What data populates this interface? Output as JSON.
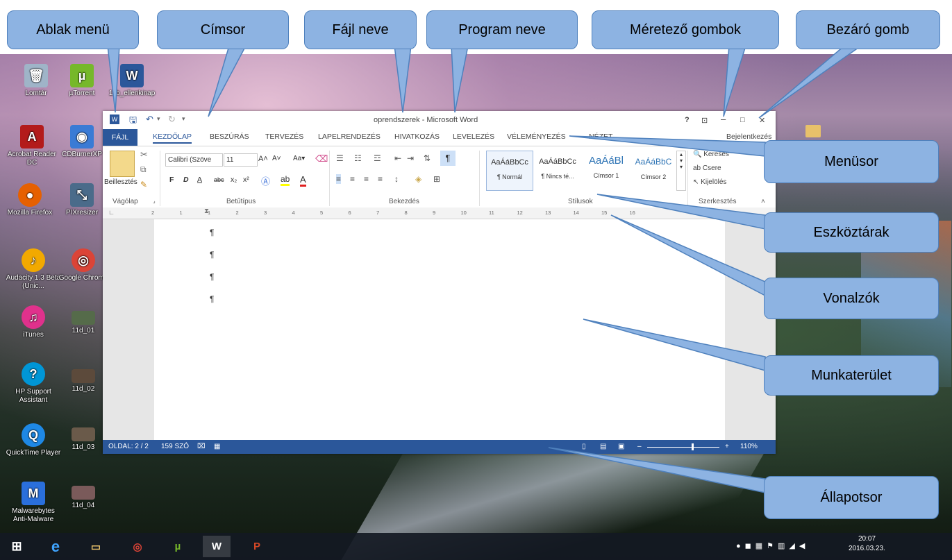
{
  "callouts": {
    "window_menu": "Ablak menü",
    "title_bar": "Címsor",
    "file_name": "Fájl neve",
    "program_name": "Program neve",
    "resize_buttons": "Méretező gombok",
    "close_button": "Bezáró gomb",
    "menubar": "Menüsor",
    "toolbars": "Eszköztárak",
    "rulers": "Vonalzók",
    "workspace": "Munkaterület",
    "statusbar": "Állapotsor"
  },
  "desktop": {
    "icons": [
      {
        "label": "Lomtár",
        "icon": "recycle-bin-icon"
      },
      {
        "label": "µTorrent",
        "icon": "utorrent-icon"
      },
      {
        "label": "11b_ellenkinap",
        "icon": "word-file-icon"
      },
      {
        "label": "Acrobat Reader DC",
        "icon": "acrobat-icon"
      },
      {
        "label": "CDBurnerXP",
        "icon": "cdburner-icon"
      },
      {
        "label": "Mozilla Firefox",
        "icon": "firefox-icon"
      },
      {
        "label": "PIXresizer",
        "icon": "pixresizer-icon"
      },
      {
        "label": "Audacity 1.3 Beta (Unic...",
        "icon": "audacity-icon"
      },
      {
        "label": "Google Chrome",
        "icon": "chrome-icon"
      },
      {
        "label": "iTunes",
        "icon": "itunes-icon"
      },
      {
        "label": "11d_01",
        "icon": "photo-icon"
      },
      {
        "label": "HP Support Assistant",
        "icon": "hp-support-icon"
      },
      {
        "label": "11d_02",
        "icon": "photo-icon"
      },
      {
        "label": "QuickTime Player",
        "icon": "quicktime-icon"
      },
      {
        "label": "11d_03",
        "icon": "photo-icon"
      },
      {
        "label": "Malwarebytes Anti-Malware",
        "icon": "malwarebytes-icon"
      },
      {
        "label": "11d_04",
        "icon": "photo-icon"
      }
    ]
  },
  "word": {
    "title": "oprendszerek - Microsoft Word",
    "title_buttons": {
      "help": "?",
      "ribbon_options": "⊡",
      "minimize": "–",
      "maximize": "□",
      "close": "✕"
    },
    "tabs": [
      "FÁJL",
      "KEZDŐLAP",
      "BESZÚRÁS",
      "TERVEZÉS",
      "LAPELRENDEZÉS",
      "HIVATKOZÁS",
      "LEVELEZÉS",
      "VÉLEMÉNYEZÉS",
      "NÉZET"
    ],
    "signin": "Bejelentkezés",
    "ribbon": {
      "paste_label": "Beillesztés",
      "font_name": "Calibri (Szöve",
      "font_size": "11",
      "font_buttons": {
        "bold": "F",
        "italic": "D",
        "underline": "A",
        "strike": "abc",
        "sub": "x₂",
        "sup": "x²"
      },
      "group_clipboard": "Vágólap",
      "group_font": "Betűtípus",
      "group_paragraph": "Bekezdés",
      "group_styles": "Stílusok",
      "group_editing": "Szerkesztés",
      "styles": [
        {
          "preview": "AaÁáBbCc",
          "name": "¶ Normál"
        },
        {
          "preview": "AaÁáBbCc",
          "name": "¶ Nincs té..."
        },
        {
          "preview": "AaÁáBl",
          "name": "Címsor 1"
        },
        {
          "preview": "AaÁáBbC",
          "name": "Címsor 2"
        }
      ],
      "edit_find": "Keresés",
      "edit_replace": "Csere",
      "edit_select": "Kijelölés"
    },
    "ruler_ticks": [
      "2",
      "1",
      "1",
      "2",
      "3",
      "4",
      "5",
      "6",
      "7",
      "8",
      "9",
      "10",
      "11",
      "12",
      "13",
      "14",
      "15",
      "16"
    ],
    "paragraph_mark": "¶",
    "status": {
      "page": "OLDAL: 2 / 2",
      "words": "159 SZÓ",
      "zoom": "110%"
    }
  },
  "taskbar": {
    "clock_time": "20:07",
    "clock_date": "2016.03.23."
  },
  "colors": {
    "word_blue": "#2b579a",
    "callout_fill": "#8db3e2",
    "callout_border": "#4f81bd"
  }
}
